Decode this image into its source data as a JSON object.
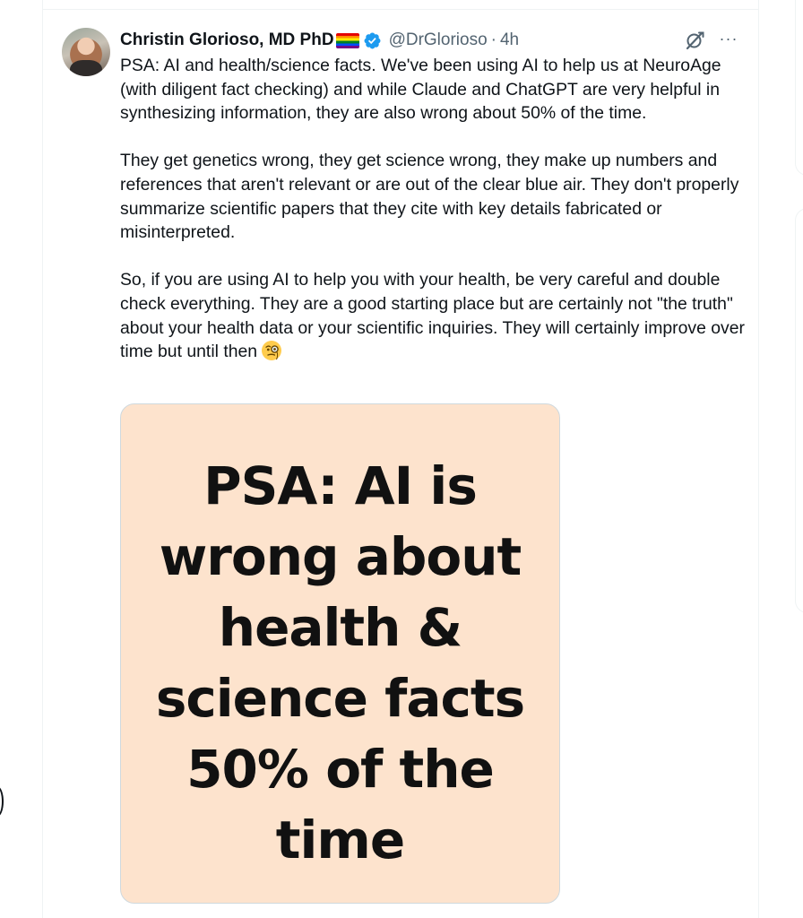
{
  "tweet": {
    "author": {
      "display_name": "Christin Glorioso, MD PhD",
      "name_emoji": "rainbow-flag",
      "verified": true,
      "handle": "@DrGlorioso",
      "separator": "·",
      "time": "4h"
    },
    "paragraphs": [
      "PSA: AI and health/science facts. We've been using AI to help us at NeuroAge (with diligent fact checking) and while Claude and ChatGPT are very helpful in synthesizing information, they are also wrong about 50% of the time.",
      "They get genetics wrong, they get science wrong, they make up numbers and references that aren't relevant or are out of the clear blue air. They don't properly summarize scientific papers that they cite with key details fabricated or misinterpreted.",
      "So, if you are using AI to help you with your health, be very careful and double check everything. They are a good starting place but are certainly not \"the truth\" about your health data or your scientific inquiries. They will certainly improve over time but until then"
    ],
    "trailing_emoji": "face-with-monocle",
    "more_label": "···",
    "media": {
      "lines": [
        "PSA: AI is",
        "wrong about",
        "health &",
        "science facts",
        "50% of the",
        "time"
      ],
      "background": "#fde3cd"
    }
  },
  "colors": {
    "text": "#0f1419",
    "secondary": "#536471",
    "verified": "#1d9bf0",
    "border": "#eff3f4"
  },
  "icons": [
    "verified-badge-icon",
    "grok-icon",
    "more-icon"
  ]
}
